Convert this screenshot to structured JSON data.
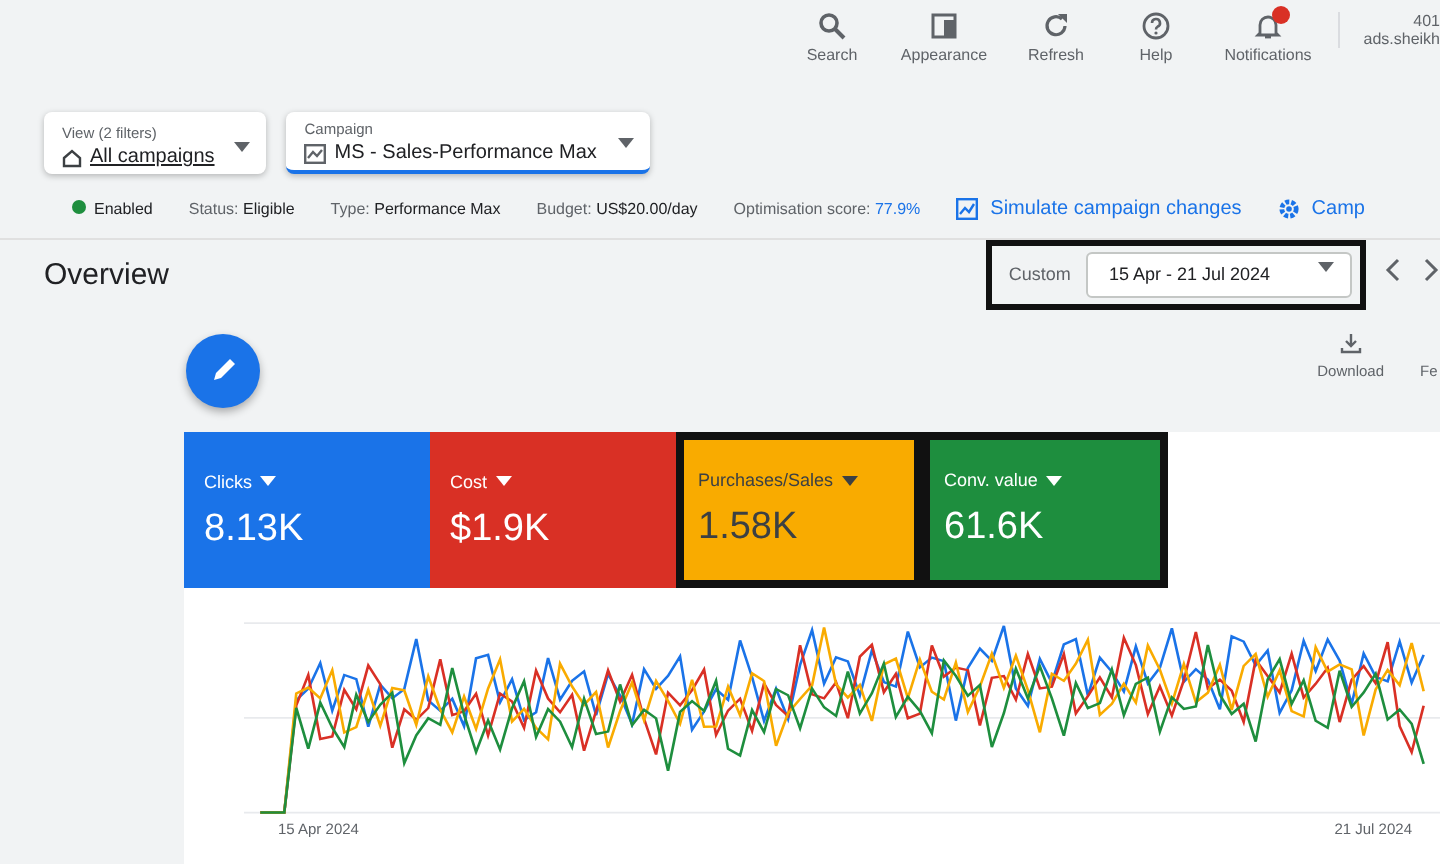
{
  "toolbar": [
    {
      "kind": "search",
      "label": "Search"
    },
    {
      "kind": "appearance",
      "label": "Appearance"
    },
    {
      "kind": "refresh",
      "label": "Refresh"
    },
    {
      "kind": "help",
      "label": "Help"
    },
    {
      "kind": "notifications",
      "label": "Notifications",
      "alert": true
    }
  ],
  "account": {
    "id": "401",
    "name": "ads.sheikh"
  },
  "filters": [
    {
      "kind": "view",
      "label": "View (2 filters)",
      "value": "All campaigns"
    },
    {
      "kind": "campaign",
      "label": "Campaign",
      "value": "MS - Sales-Performance Max"
    }
  ],
  "status_bar": {
    "state": "Enabled",
    "status_label": "Status:",
    "status": "Eligible",
    "type_label": "Type:",
    "type": "Performance Max",
    "budget_label": "Budget:",
    "budget": "US$20.00/day",
    "score_label": "Optimisation score:",
    "score": "77.9%",
    "simulate": "Simulate campaign changes",
    "campaign_settings": "Camp"
  },
  "overview": {
    "title": "Overview",
    "range_label": "Custom",
    "range": "15 Apr - 21 Jul 2024",
    "highlighted": true
  },
  "actions": [
    {
      "kind": "download",
      "label": "Download"
    },
    {
      "kind": "feedback",
      "label": "Fe"
    }
  ],
  "metrics": [
    {
      "label": "Clicks",
      "value": "8.13K",
      "color": "#1a73e8",
      "highlighted": false
    },
    {
      "label": "Cost",
      "value": "$1.9K",
      "color": "#d93025",
      "highlighted": false
    },
    {
      "label": "Purchases/Sales",
      "value": "1.58K",
      "color": "#f9ab00",
      "highlighted": true
    },
    {
      "label": "Conv. value",
      "value": "61.6K",
      "color": "#1e8e3e",
      "highlighted": true
    }
  ],
  "chart": {
    "start": "15 Apr 2024",
    "end": "21 Jul 2024"
  }
}
